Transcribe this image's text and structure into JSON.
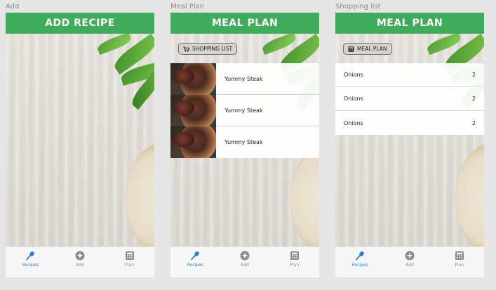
{
  "artboards": [
    {
      "label": "Add",
      "header": "ADD RECIPE",
      "tabs": [
        {
          "label": "Recipes",
          "icon": "spoon-icon",
          "active": true
        },
        {
          "label": "Add",
          "icon": "plus-circle-icon",
          "active": false
        },
        {
          "label": "Plan",
          "icon": "calculator-icon",
          "active": false
        }
      ]
    },
    {
      "label": "Meal Plan",
      "header": "MEAL PLAN",
      "pill": {
        "label": "SHOPPING LIST",
        "icon": "cart-icon"
      },
      "meals": [
        {
          "name": "Yummy Steak"
        },
        {
          "name": "Yummy Steak"
        },
        {
          "name": "Yummy Steak"
        }
      ],
      "tabs": [
        {
          "label": "Recipes",
          "icon": "spoon-icon",
          "active": true
        },
        {
          "label": "Add",
          "icon": "plus-circle-icon",
          "active": false
        },
        {
          "label": "Plan",
          "icon": "calculator-icon",
          "active": false
        }
      ]
    },
    {
      "label": "Shopping list",
      "header": "MEAL PLAN",
      "pill": {
        "label": "MEAL PLAN",
        "icon": "calculator-icon"
      },
      "items": [
        {
          "name": "Onions",
          "qty": "2"
        },
        {
          "name": "Onions",
          "qty": "2"
        },
        {
          "name": "Onions",
          "qty": "2"
        }
      ],
      "tabs": [
        {
          "label": "Recipes",
          "icon": "spoon-icon",
          "active": true
        },
        {
          "label": "Add",
          "icon": "plus-circle-icon",
          "active": false
        },
        {
          "label": "Plan",
          "icon": "calculator-icon",
          "active": false
        }
      ]
    }
  ],
  "colors": {
    "header_green": "#3fac5b",
    "tab_active": "#2d7fd9",
    "tab_inactive": "#8a8a8a"
  }
}
